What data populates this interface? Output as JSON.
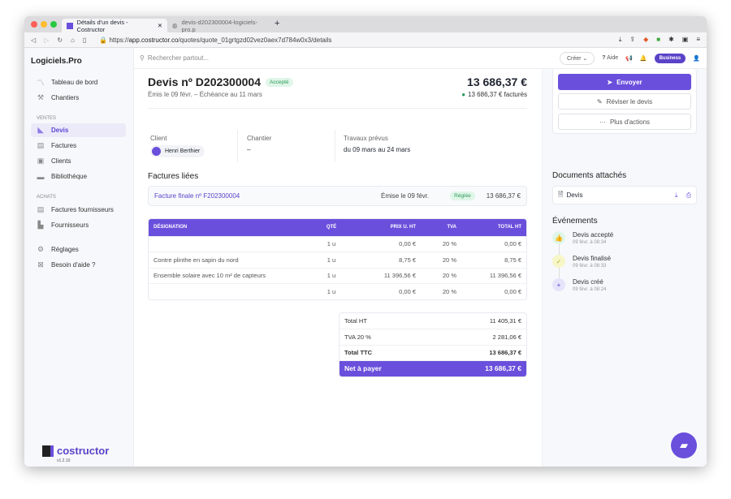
{
  "browser": {
    "tabs": [
      {
        "label": "Détails d'un devis - Costructor",
        "active": true
      },
      {
        "label": "devis-d202300004-logiciels-pro.p"
      }
    ],
    "url_prefix": "https://",
    "url_host": "app.costructor.co",
    "url_path": "/quotes/quote_01grtgzd02vez0aex7d784w0x3/details"
  },
  "sidebar": {
    "brand": "Logiciels.Pro",
    "items": [
      {
        "label": "Tableau de bord",
        "icon": "chart-line-icon"
      },
      {
        "label": "Chantiers",
        "icon": "worker-icon"
      }
    ],
    "ventes_title": "VENTES",
    "ventes": [
      {
        "label": "Devis",
        "active": true
      },
      {
        "label": "Factures"
      },
      {
        "label": "Clients"
      },
      {
        "label": "Bibliothèque"
      }
    ],
    "achats_title": "ACHATS",
    "achats": [
      {
        "label": "Factures fournisseurs"
      },
      {
        "label": "Fournisseurs"
      }
    ],
    "bottom": [
      {
        "label": "Réglages"
      },
      {
        "label": "Besoin d'aide ?"
      }
    ],
    "logo": "costructor",
    "version": "v1.2.10"
  },
  "topbar": {
    "search_placeholder": "Rechercher partout...",
    "create": "Créer",
    "help": "Aide",
    "plan": "Business"
  },
  "quote": {
    "title": "Devis nº D202300004",
    "status": "Accepté",
    "dates": "Émis le 09 févr. –  Échéance au 11 mars",
    "total": "13 686,37 €",
    "invoiced": "13 686,37 € facturés",
    "client_label": "Client",
    "client": "Henri Berthier",
    "site_label": "Chantier",
    "site": "–",
    "works_label": "Travaux prévus",
    "works": "du 09 mars au 24 mars"
  },
  "invoices": {
    "title": "Factures liées",
    "items": [
      {
        "name": "Facture finale nº F202300004",
        "date": "Émise le 09 févr.",
        "status": "Réglée",
        "amount": "13 686,37 €"
      }
    ]
  },
  "table": {
    "headers": [
      "DÉSIGNATION",
      "QTÉ",
      "PRIX U. HT",
      "TVA",
      "TOTAL HT"
    ],
    "rows": [
      [
        "",
        "1 u",
        "0,00 €",
        "20 %",
        "0,00 €"
      ],
      [
        "Contre plinthe en sapin du nord",
        "1 u",
        "8,75 €",
        "20 %",
        "8,75 €"
      ],
      [
        "Ensemble solaire avec 10 m² de capteurs",
        "1 u",
        "11 396,56 €",
        "20 %",
        "11 396,56 €"
      ],
      [
        "",
        "1 u",
        "0,00 €",
        "20 %",
        "0,00 €"
      ]
    ]
  },
  "totals": [
    {
      "label": "Total HT",
      "value": "11 405,31 €"
    },
    {
      "label": "TVA 20 %",
      "value": "2 281,06 €"
    },
    {
      "label": "Total TTC",
      "value": "13 686,37 €"
    },
    {
      "label": "Net à payer",
      "value": "13 686,37 €"
    }
  ],
  "actions": {
    "send": "Envoyer",
    "revise": "Réviser le devis",
    "more": "Plus d'actions"
  },
  "documents": {
    "title": "Documents attachés",
    "items": [
      {
        "name": "Devis"
      }
    ]
  },
  "events": {
    "title": "Événements",
    "items": [
      {
        "label": "Devis accepté",
        "date": "09 févr. à 08:34",
        "color": "#dff6e8"
      },
      {
        "label": "Devis finalisé",
        "date": "09 févr. à 08:33",
        "color": "#f6f6c8"
      },
      {
        "label": "Devis créé",
        "date": "09 févr. à 08:24",
        "color": "#e6e4fb"
      }
    ]
  },
  "colors": {
    "accent": "#6a4fdc",
    "success": "#2e9a5b"
  }
}
